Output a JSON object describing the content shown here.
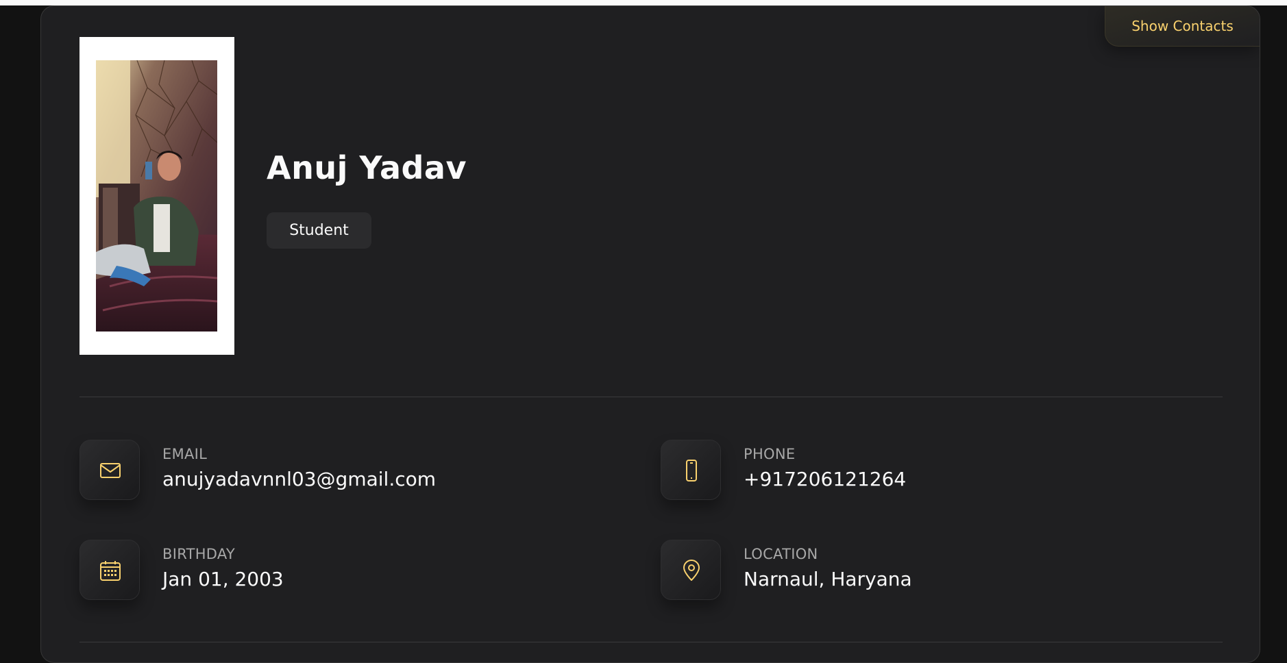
{
  "profile": {
    "name": "Anuj Yadav",
    "title": "Student",
    "show_contacts_label": "Show Contacts"
  },
  "contacts": [
    {
      "label": "EMAIL",
      "value": "anujyadavnnl03@gmail.com",
      "icon": "mail-icon"
    },
    {
      "label": "PHONE",
      "value": "+917206121264",
      "icon": "phone-icon"
    },
    {
      "label": "BIRTHDAY",
      "value": "Jan 01, 2003",
      "icon": "calendar-icon"
    },
    {
      "label": "LOCATION",
      "value": "Narnaul, Haryana",
      "icon": "location-pin-icon"
    }
  ],
  "colors": {
    "accent": "#fad26e",
    "card_background": "#1f1f21",
    "page_background": "#121212"
  }
}
